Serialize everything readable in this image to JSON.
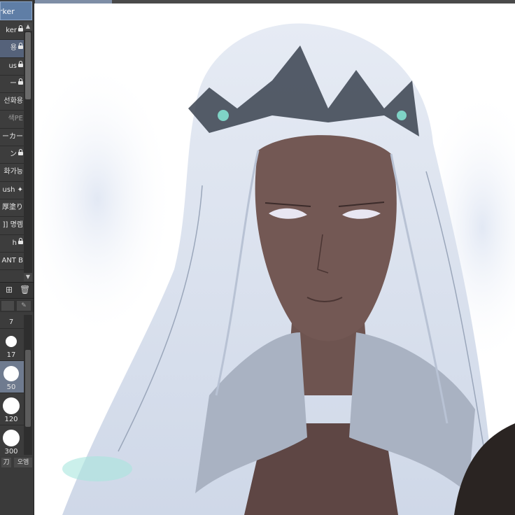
{
  "tool_header": "rker",
  "brush_list": [
    {
      "label": "ker",
      "locked": true,
      "selected": false,
      "dim": false
    },
    {
      "label": "용",
      "locked": true,
      "selected": true,
      "dim": false
    },
    {
      "label": "us",
      "locked": true,
      "selected": false,
      "dim": false
    },
    {
      "label": "ー",
      "locked": true,
      "selected": false,
      "dim": false
    },
    {
      "label": "선화용",
      "locked": false,
      "selected": false,
      "dim": false
    },
    {
      "label": "색PE",
      "locked": false,
      "selected": false,
      "dim": true
    },
    {
      "label": "ーカー",
      "locked": false,
      "selected": false,
      "dim": false
    },
    {
      "label": "ン",
      "locked": true,
      "selected": false,
      "dim": false
    },
    {
      "label": "화가능",
      "locked": false,
      "selected": false,
      "dim": false
    },
    {
      "label": "ush ✦",
      "locked": false,
      "selected": false,
      "dim": false
    },
    {
      "label": "厚塗り",
      "locked": false,
      "selected": false,
      "dim": false
    },
    {
      "label": "]] 명렘",
      "locked": false,
      "selected": false,
      "dim": false
    },
    {
      "label": "h",
      "locked": true,
      "selected": false,
      "dim": false
    },
    {
      "label": "ANT B",
      "locked": false,
      "selected": false,
      "dim": false
    }
  ],
  "brush_sizes": [
    {
      "value": "7",
      "selected": false
    },
    {
      "value": "17",
      "selected": false
    },
    {
      "value": "50",
      "selected": true
    },
    {
      "value": "120",
      "selected": false
    },
    {
      "value": "300",
      "selected": false
    }
  ],
  "icons": {
    "add": "add-brush-icon",
    "delete": "trash-icon",
    "pen": "pen-icon"
  },
  "bottom_buttons": [
    "刀",
    "오엠"
  ],
  "colors": {
    "panel_bg": "#3c3c3c",
    "selected_item": "#55627a",
    "header": "#5f7ea6",
    "skin": "#6e5450",
    "hair": "#dde3ee"
  }
}
